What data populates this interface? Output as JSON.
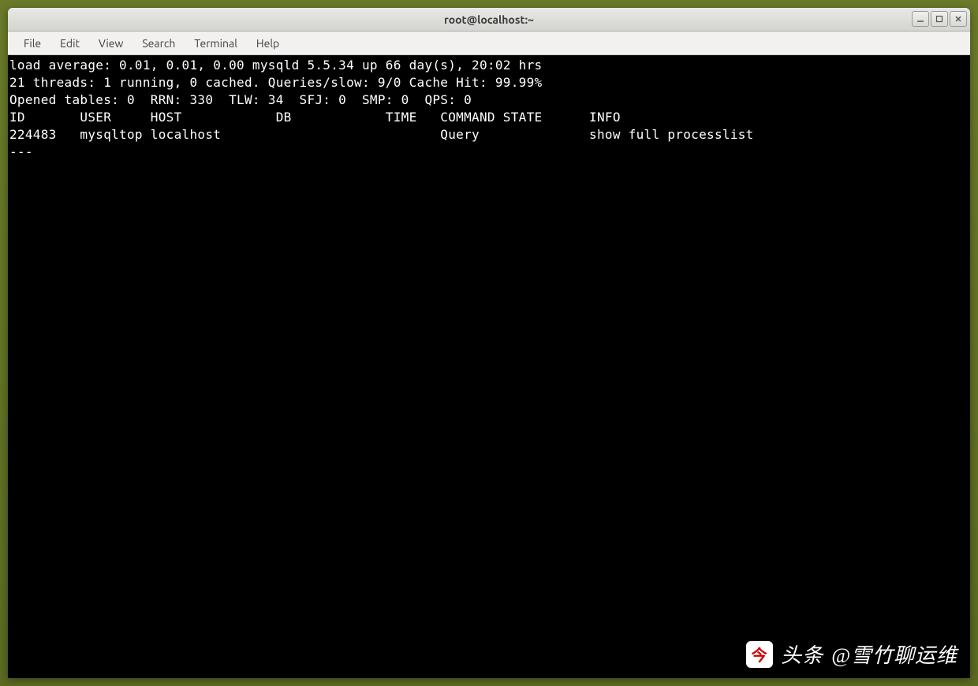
{
  "window": {
    "title": "root@localhost:~"
  },
  "menu": {
    "file": "File",
    "edit": "Edit",
    "view": "View",
    "search": "Search",
    "terminal": "Terminal",
    "help": "Help"
  },
  "terminal": {
    "line1": "load average: 0.01, 0.01, 0.00 mysqld 5.5.34 up 66 day(s), 20:02 hrs",
    "line2": "21 threads: 1 running, 0 cached. Queries/slow: 9/0 Cache Hit: 99.99%",
    "line3": "Opened tables: 0  RRN: 330  TLW: 34  SFJ: 0  SMP: 0  QPS: 0",
    "blank": "",
    "header": "ID       USER     HOST            DB            TIME   COMMAND STATE      INFO",
    "row1": "224483   mysqltop localhost                            Query              show full processlist",
    "dash": "---"
  },
  "stats": {
    "load_average": [
      0.01,
      0.01,
      0.0
    ],
    "mysqld_version": "5.5.34",
    "uptime_days": 66,
    "uptime_hrs": "20:02",
    "threads_total": 21,
    "threads_running": 1,
    "threads_cached": 0,
    "queries": 9,
    "slow": 0,
    "cache_hit_pct": 99.99,
    "opened_tables": 0,
    "rrn": 330,
    "tlw": 34,
    "sfj": 0,
    "smp": 0,
    "qps": 0
  },
  "process_columns": [
    "ID",
    "USER",
    "HOST",
    "DB",
    "TIME",
    "COMMAND",
    "STATE",
    "INFO"
  ],
  "processes": [
    {
      "id": "224483",
      "user": "mysqltop",
      "host": "localhost",
      "db": "",
      "time": "",
      "command": "Query",
      "state": "",
      "info": "show full processlist"
    }
  ],
  "watermark": {
    "prefix": "头条",
    "handle": "@雪竹聊运维",
    "logo_char": "今"
  }
}
